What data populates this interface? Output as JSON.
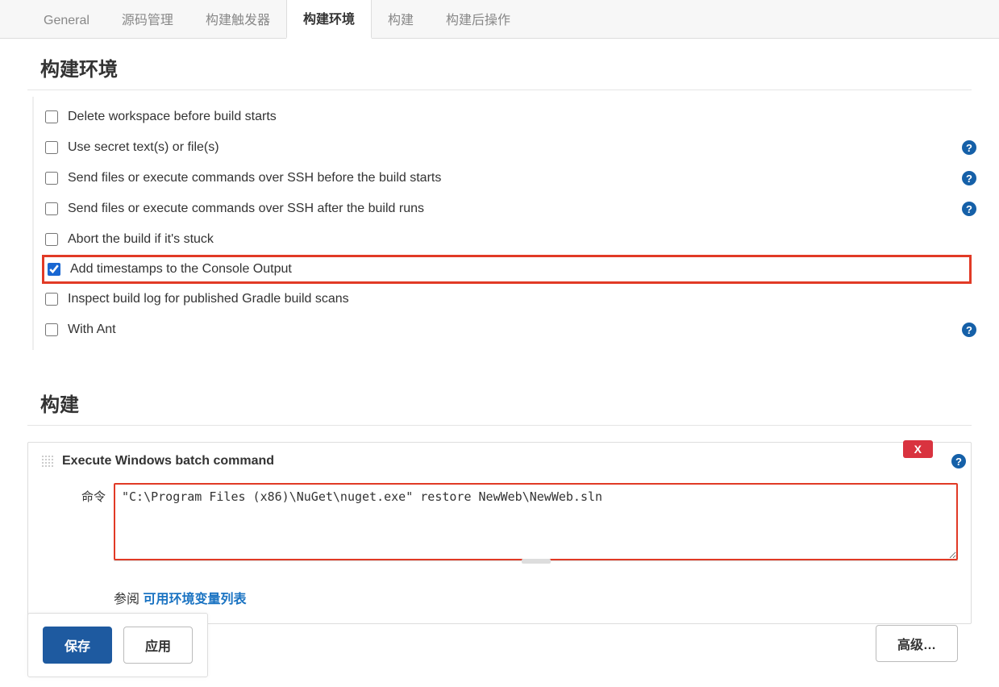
{
  "tabs": [
    {
      "label": "General"
    },
    {
      "label": "源码管理"
    },
    {
      "label": "构建触发器"
    },
    {
      "label": "构建环境",
      "active": true
    },
    {
      "label": "构建"
    },
    {
      "label": "构建后操作"
    }
  ],
  "env_section_title": "构建环境",
  "env_options": [
    {
      "label": "Delete workspace before build starts",
      "checked": false,
      "has_help": false
    },
    {
      "label": "Use secret text(s) or file(s)",
      "checked": false,
      "has_help": true
    },
    {
      "label": "Send files or execute commands over SSH before the build starts",
      "checked": false,
      "has_help": true
    },
    {
      "label": "Send files or execute commands over SSH after the build runs",
      "checked": false,
      "has_help": true
    },
    {
      "label": "Abort the build if it's stuck",
      "checked": false,
      "has_help": false
    },
    {
      "label": "Add timestamps to the Console Output",
      "checked": true,
      "has_help": false,
      "highlight": true
    },
    {
      "label": "Inspect build log for published Gradle build scans",
      "checked": false,
      "has_help": false
    },
    {
      "label": "With Ant",
      "checked": false,
      "has_help": true
    }
  ],
  "build_section_title": "构建",
  "build_step": {
    "title": "Execute Windows batch command",
    "delete_label": "X",
    "command_label": "命令",
    "command_value": "\"C:\\Program Files (x86)\\NuGet\\nuget.exe\" restore NewWeb\\NewWeb.sln",
    "see_also_prefix": "参阅 ",
    "see_also_link": "可用环境变量列表",
    "advanced_label": "高级…"
  },
  "footer": {
    "save_label": "保存",
    "apply_label": "应用"
  }
}
